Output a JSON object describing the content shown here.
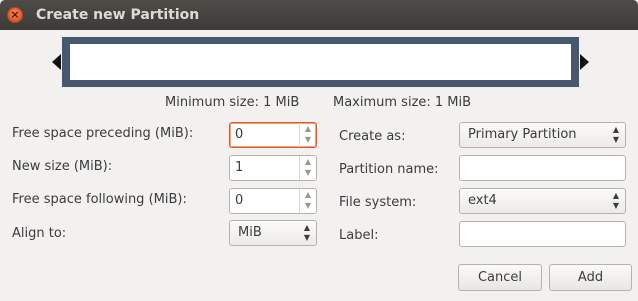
{
  "window": {
    "title": "Create new Partition",
    "close_icon": "close-icon"
  },
  "sizes": {
    "minimum": "Minimum size: 1 MiB",
    "maximum": "Maximum size: 1 MiB"
  },
  "left": {
    "free_preceding_label": "Free space preceding (MiB):",
    "free_preceding_value": "0",
    "new_size_label": "New size (MiB):",
    "new_size_value": "1",
    "free_following_label": "Free space following (MiB):",
    "free_following_value": "0",
    "align_label": "Align to:",
    "align_value": "MiB"
  },
  "right": {
    "create_as_label": "Create as:",
    "create_as_value": "Primary Partition",
    "partition_name_label": "Partition name:",
    "partition_name_value": "",
    "file_system_label": "File system:",
    "file_system_value": "ext4",
    "label_label": "Label:",
    "label_value": ""
  },
  "buttons": {
    "cancel": "Cancel",
    "add": "Add"
  },
  "colors": {
    "accent": "#e05a28",
    "partition_frame": "#46586d",
    "titlebar": "#3c3b37"
  }
}
